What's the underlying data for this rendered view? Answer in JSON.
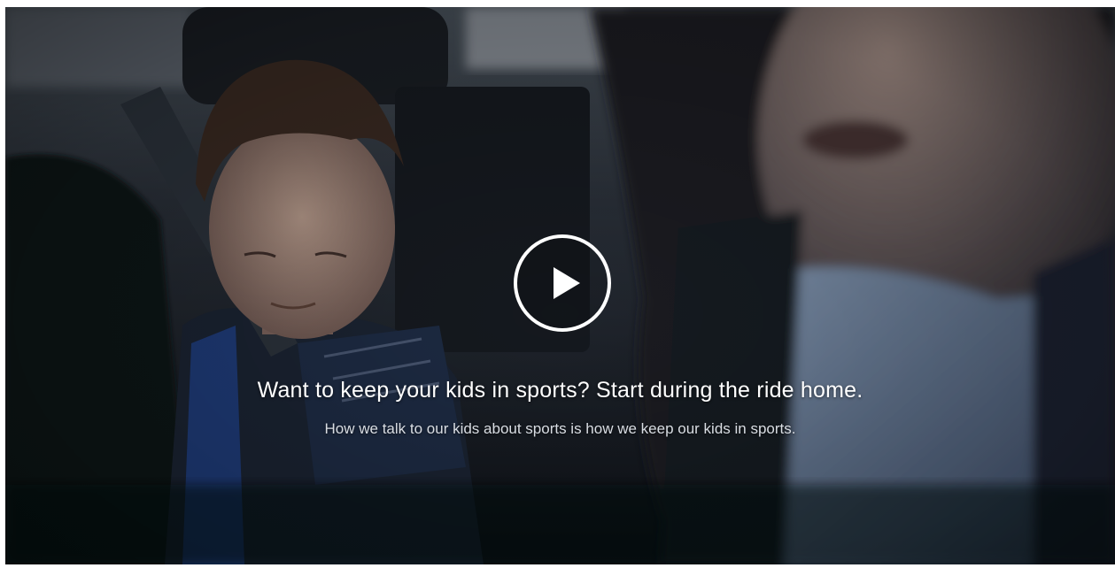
{
  "video": {
    "headline": "Want to keep your kids in sports? Start during the ride home.",
    "subheadline": "How we talk to our kids about sports is how we keep our kids in sports.",
    "play_icon": "play-icon"
  },
  "colors": {
    "text_primary": "#ffffff",
    "text_secondary": "#d9dde3",
    "play_ring": "#ffffff"
  }
}
